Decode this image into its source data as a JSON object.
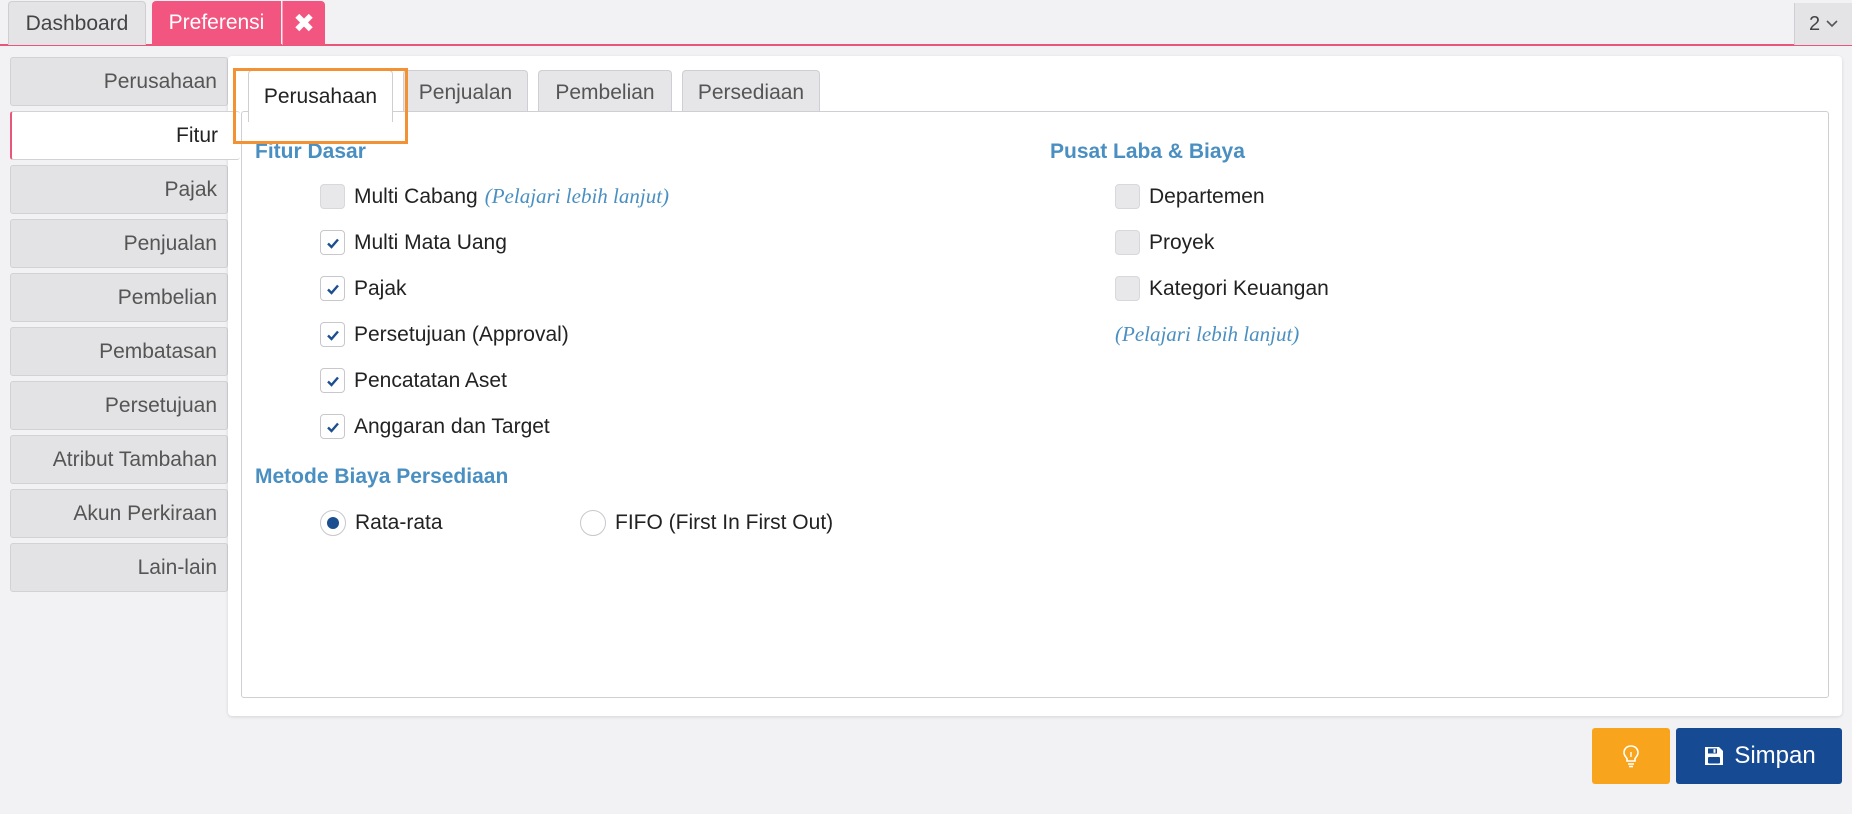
{
  "top_tabs": {
    "dashboard": "Dashboard",
    "preferensi": "Preferensi",
    "close_glyph": "✖",
    "count": "2"
  },
  "sidebar": {
    "items": [
      {
        "label": "Perusahaan"
      },
      {
        "label": "Fitur"
      },
      {
        "label": "Pajak"
      },
      {
        "label": "Penjualan"
      },
      {
        "label": "Pembelian"
      },
      {
        "label": "Pembatasan"
      },
      {
        "label": "Persetujuan"
      },
      {
        "label": "Atribut Tambahan"
      },
      {
        "label": "Akun Perkiraan"
      },
      {
        "label": "Lain-lain"
      }
    ],
    "active_index": 1
  },
  "subtabs": [
    {
      "label": "Perusahaan"
    },
    {
      "label": "Penjualan"
    },
    {
      "label": "Pembelian"
    },
    {
      "label": "Persediaan"
    }
  ],
  "fitur_dasar": {
    "title": "Fitur Dasar",
    "options": [
      {
        "label": "Multi Cabang",
        "checked": false,
        "link": "(Pelajari lebih lanjut)"
      },
      {
        "label": "Multi Mata Uang",
        "checked": true
      },
      {
        "label": "Pajak",
        "checked": true
      },
      {
        "label": "Persetujuan (Approval)",
        "checked": true
      },
      {
        "label": "Pencatatan Aset",
        "checked": true
      },
      {
        "label": "Anggaran dan Target",
        "checked": true
      }
    ]
  },
  "pusat_laba": {
    "title": "Pusat Laba & Biaya",
    "options": [
      {
        "label": "Departemen",
        "checked": false
      },
      {
        "label": "Proyek",
        "checked": false
      },
      {
        "label": "Kategori Keuangan",
        "checked": false
      }
    ],
    "link": "(Pelajari lebih lanjut)"
  },
  "metode_biaya": {
    "title": "Metode Biaya Persediaan",
    "options": [
      {
        "label": "Rata-rata",
        "selected": true
      },
      {
        "label": "FIFO (First In First Out)",
        "selected": false
      }
    ]
  },
  "buttons": {
    "save_label": "Simpan"
  },
  "colors": {
    "accent_pink": "#f2557f",
    "section_blue": "#4a8fc1",
    "save_blue": "#164b94",
    "idea_orange": "#f8a51d",
    "highlight_orange": "#f39235"
  }
}
